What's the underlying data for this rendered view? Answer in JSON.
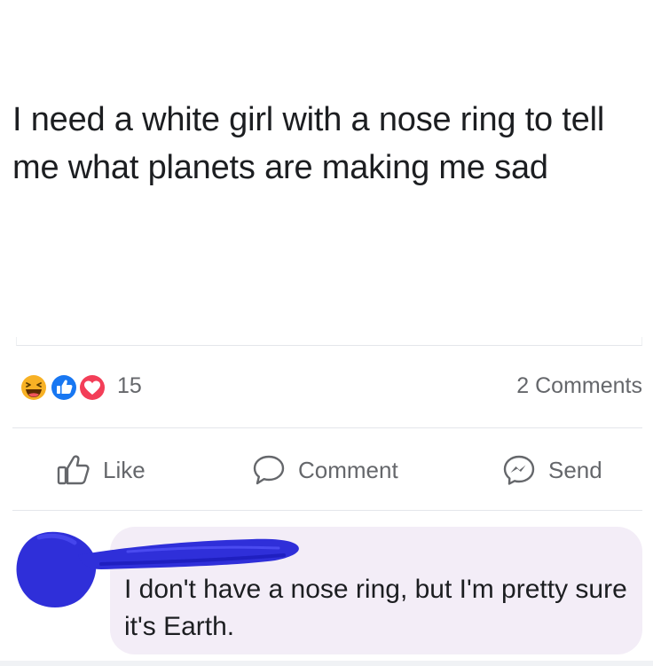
{
  "post": {
    "text": "I need a white girl with a nose ring to tell me what planets are making me sad"
  },
  "reactions": {
    "icons": [
      "haha-icon",
      "like-icon",
      "love-icon"
    ],
    "count": "15",
    "comments_count": "2 Comments"
  },
  "actions": {
    "like_label": "Like",
    "comment_label": "Comment",
    "send_label": "Send"
  },
  "comment": {
    "text": "I don't have a nose ring, but I'm pretty sure it's Earth."
  },
  "colors": {
    "like_blue": "#1877f2",
    "love_red": "#f33e58",
    "haha_yellow": "#f7b125",
    "scribble_blue": "#2f2fd9",
    "muted_text": "#65676b",
    "comment_bubble": "#f3edf7"
  }
}
